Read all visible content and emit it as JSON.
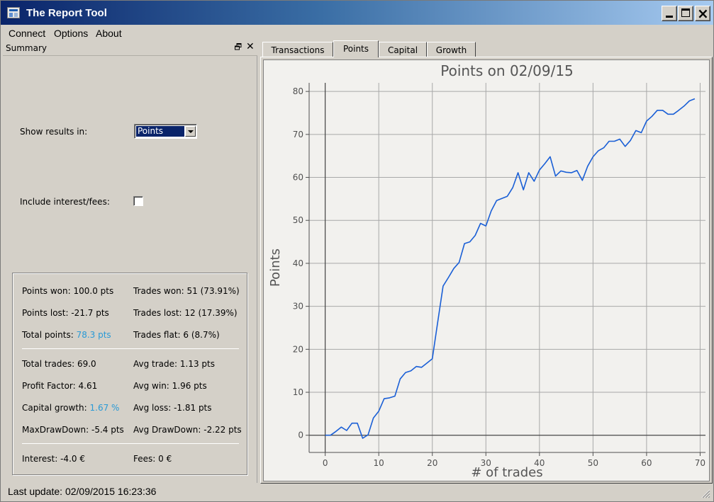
{
  "window": {
    "title": "The Report Tool"
  },
  "menu": [
    "Connect",
    "Options",
    "About"
  ],
  "summary_dock": {
    "title": "Summary",
    "show_results_label": "Show results in:",
    "show_results_value": "Points",
    "include_fees_label": "Include interest/fees:",
    "include_fees_checked": false
  },
  "stats": {
    "points_won": "Points won: 100.0 pts",
    "trades_won": "Trades won: 51 (73.91%)",
    "points_lost": "Points lost: -21.7 pts",
    "trades_lost": "Trades lost: 12 (17.39%)",
    "total_points_label": "Total points: ",
    "total_points_value": "78.3 pts",
    "trades_flat": "Trades flat: 6 (8.7%)",
    "total_trades": "Total trades: 69.0",
    "avg_trade": "Avg trade: 1.13 pts",
    "profit_factor": "Profit Factor: 4.61",
    "avg_win": "Avg win: 1.96 pts",
    "capital_growth_label": "Capital growth: ",
    "capital_growth_value": "1.67 %",
    "avg_loss": "Avg loss: -1.81 pts",
    "max_drawdown": "MaxDrawDown: -5.4 pts",
    "avg_drawdown": "Avg DrawDown: -2.22 pts",
    "interest": "Interest: -4.0 €",
    "fees": "Fees: 0 €",
    "highlight_color": "#2a9ad6"
  },
  "tabs": [
    "Transactions",
    "Points",
    "Capital",
    "Growth"
  ],
  "active_tab": "Points",
  "status": {
    "text": "Last update: 02/09/2015 16:23:36"
  },
  "chart_data": {
    "type": "line",
    "title": "Points on 02/09/15",
    "xlabel": "# of trades",
    "ylabel": "Points",
    "xlim": [
      -3,
      71
    ],
    "ylim": [
      -4,
      82
    ],
    "xticks": [
      0,
      10,
      20,
      30,
      40,
      50,
      60,
      70
    ],
    "yticks": [
      0,
      10,
      20,
      30,
      40,
      50,
      60,
      70,
      80
    ],
    "grid": true,
    "line_color": "#1a5fd6",
    "series": [
      {
        "x": [
          0,
          1,
          2,
          3,
          4,
          5,
          6,
          7,
          8,
          9,
          10,
          11,
          12,
          13,
          14,
          15,
          16,
          17,
          18,
          19,
          20,
          21,
          22,
          23,
          24,
          25,
          26,
          27,
          28,
          29,
          30,
          31,
          32,
          33,
          34,
          35,
          36,
          37,
          38,
          39,
          40,
          41,
          42,
          43,
          44,
          45,
          46,
          47,
          48,
          49,
          50,
          51,
          52,
          53,
          54,
          55,
          56,
          57,
          58,
          59,
          60,
          61,
          62,
          63,
          64,
          65,
          66,
          67,
          68,
          69
        ],
        "y": [
          0,
          0,
          0.9,
          1.9,
          1.1,
          2.8,
          2.8,
          -0.7,
          0.1,
          4,
          5.6,
          8.5,
          8.7,
          9.1,
          13.1,
          14.6,
          15,
          16,
          15.8,
          16.8,
          17.8,
          26.3,
          34.7,
          36.7,
          38.8,
          40.2,
          44.6,
          45,
          46.5,
          49.3,
          48.7,
          52.2,
          54.6,
          55.1,
          55.6,
          57.6,
          61.1,
          57.1,
          61.1,
          59.1,
          61.7,
          63.2,
          64.8,
          60.3,
          61.5,
          61.2,
          61.1,
          61.6,
          59.3,
          62.6,
          64.8,
          66.2,
          66.9,
          68.4,
          68.4,
          68.9,
          67.2,
          68.6,
          70.9,
          70.4,
          73.1,
          74.2,
          75.6,
          75.6,
          74.7,
          74.7,
          75.6,
          76.6,
          77.8,
          78.3
        ]
      }
    ]
  }
}
